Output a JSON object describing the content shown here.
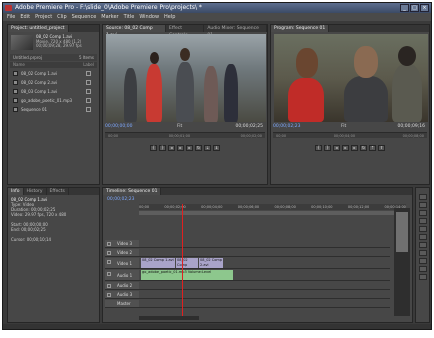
{
  "window": {
    "title": "Adobe Premiere Pro - F:\\slide_0\\Adobe Premiere Pro\\projects\\ *"
  },
  "menu": [
    "File",
    "Edit",
    "Project",
    "Clip",
    "Sequence",
    "Marker",
    "Title",
    "Window",
    "Help"
  ],
  "project_panel": {
    "tab": "Project: untitled_project",
    "selected_clip": {
      "name": "08_02 Comp 1.avi",
      "line1": "Movie, 720 x 480 (1.2)",
      "line2": "00;00;09;28, 29.97 fps"
    },
    "bin_label": "Untitled.prproj",
    "item_count": "5 Items",
    "col_name": "Name",
    "col_label": "Label",
    "items": [
      "08_02 Comp 1.avi",
      "08_02 Comp 2.avi",
      "08_03 Comp 1.avi",
      "go_adobe_poetic_01.mp3",
      "Sequence 01"
    ]
  },
  "source_monitor": {
    "tabs": [
      "Source: 08_02 Comp 1.avi",
      "Effect Controls",
      "Audio Mixer: Sequence 01"
    ],
    "timecode": "00;00;00;00",
    "duration": "00;00;02;25",
    "zoom": "Fit",
    "ruler": [
      "00;00",
      "00;00;01;00",
      "00;00;02;00"
    ]
  },
  "program_monitor": {
    "tabs": [
      "Program: Sequence 01"
    ],
    "timecode": "00;00;02;23",
    "duration": "00;00;09;16",
    "zoom": "Fit",
    "ruler": [
      "00;00",
      "00;00;04;00",
      "00;00;08;00"
    ]
  },
  "info_panel": {
    "tabs": [
      "Info",
      "History",
      "Effects"
    ],
    "clip": "08_02 Comp 1.avi",
    "lines": [
      "Type: Video",
      "Duration: 00;00;02;25",
      "Video: 29.97 fps, 720 x 480",
      "",
      "Start: 00;00;00;00",
      "End: 00;00;02;25",
      "",
      "Cursor: 00;00;10;14"
    ]
  },
  "timeline": {
    "tab": "Timeline: Sequence 01",
    "timecode": "00;00;02;23",
    "ruler": [
      "00;00",
      "00;00;02;00",
      "00;00;04;00",
      "00;00;06;00",
      "00;00;08;00",
      "00;00;10;00",
      "00;00;12;00",
      "00;00;14;00"
    ],
    "tracks": [
      {
        "name": "Video 3",
        "clips": []
      },
      {
        "name": "Video 2",
        "clips": []
      },
      {
        "name": "Video 1",
        "clips": [
          "08_02 Comp 1.avi",
          "08_02 Comp",
          "08_02 Comp 2.avi"
        ]
      },
      {
        "name": "Audio 1",
        "clips": [
          "go_adobe_poetic_01.mp3 Volume:Level"
        ]
      },
      {
        "name": "Audio 2",
        "clips": []
      },
      {
        "name": "Audio 3",
        "clips": []
      },
      {
        "name": "Master",
        "clips": []
      }
    ],
    "playhead_fraction": 0.17
  },
  "colors": {
    "accent_timecode": "#7ea9ff",
    "video_clip": "#a9a3c9",
    "audio_clip": "#8dc78d",
    "playhead": "#e02020"
  }
}
